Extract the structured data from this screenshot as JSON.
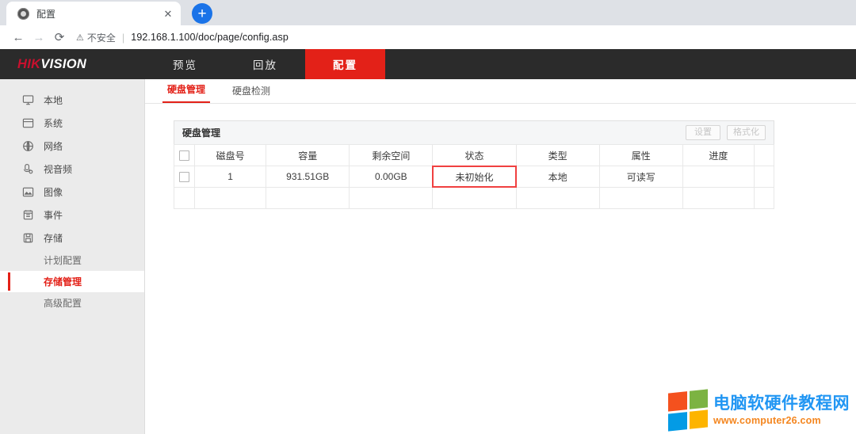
{
  "browser": {
    "tab": {
      "title": "配置",
      "favicon": "camera-icon",
      "close_label": "✕"
    },
    "new_tab_label": "+",
    "nav": {
      "back": "←",
      "forward": "→",
      "reload": "⟳"
    },
    "omnibox": {
      "security_icon": "warning-triangle-icon",
      "security_label": "不安全",
      "separator": "|",
      "url": "192.168.1.100/doc/page/config.asp"
    }
  },
  "app": {
    "brand": {
      "part1": "HIK",
      "part2": "VISION"
    },
    "topnav": [
      {
        "label": "预览",
        "active": false
      },
      {
        "label": "回放",
        "active": false
      },
      {
        "label": "配置",
        "active": true
      }
    ]
  },
  "sidebar": {
    "items": [
      {
        "label": "本地",
        "icon": "monitor-icon"
      },
      {
        "label": "系统",
        "icon": "window-icon"
      },
      {
        "label": "网络",
        "icon": "globe-icon"
      },
      {
        "label": "视音频",
        "icon": "microphone-icon"
      },
      {
        "label": "图像",
        "icon": "image-icon"
      },
      {
        "label": "事件",
        "icon": "calendar-icon"
      },
      {
        "label": "存储",
        "icon": "save-disk-icon"
      }
    ],
    "subitems": [
      {
        "label": "计划配置",
        "active": false
      },
      {
        "label": "存储管理",
        "active": true
      },
      {
        "label": "高级配置",
        "active": false
      }
    ]
  },
  "main": {
    "subtabs": [
      {
        "label": "硬盘管理",
        "active": true
      },
      {
        "label": "硬盘检测",
        "active": false
      }
    ],
    "panel": {
      "title": "硬盘管理",
      "buttons": [
        {
          "label": "设置",
          "disabled": true
        },
        {
          "label": "格式化",
          "disabled": true
        }
      ],
      "table": {
        "headers": [
          "",
          "磁盘号",
          "容量",
          "剩余空间",
          "状态",
          "类型",
          "属性",
          "进度",
          ""
        ],
        "rows": [
          {
            "checked": false,
            "disk_no": "1",
            "capacity": "931.51GB",
            "free_space": "0.00GB",
            "status": "未初始化",
            "type": "本地",
            "property": "可读写",
            "progress": "",
            "extra": "",
            "status_highlighted": true
          }
        ]
      }
    }
  },
  "watermark": {
    "title": "电脑软硬件教程网",
    "url": "www.computer26.com",
    "logo": "windows-logo",
    "colors": {
      "q1": "#f4511e",
      "q2": "#7cb342",
      "q3": "#039be5",
      "q4": "#fdb400",
      "title": "#2196f3",
      "url": "#f4861f"
    }
  },
  "colors": {
    "brand_red": "#e32118",
    "topbar": "#2b2b2b",
    "sidebar": "#ebebeb",
    "highlight": "#f04040"
  }
}
